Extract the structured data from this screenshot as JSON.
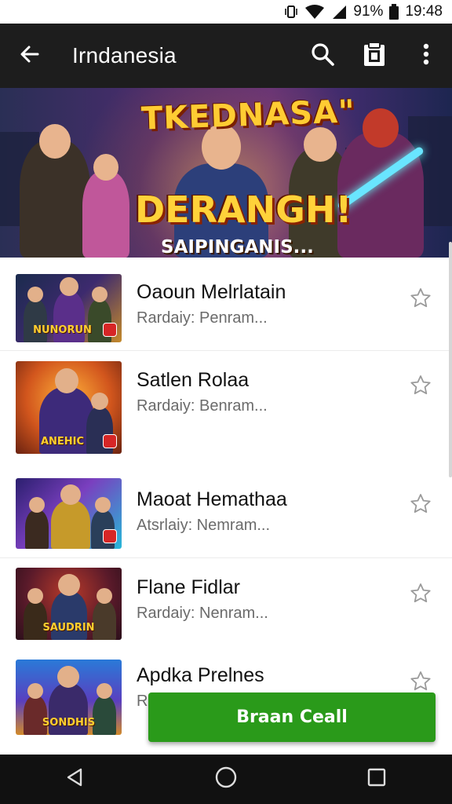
{
  "status_bar": {
    "battery_percent_label": "91%",
    "time": "19:48",
    "icons": [
      "vibrate-icon",
      "wifi-icon",
      "signal-icon",
      "battery-icon"
    ]
  },
  "app_bar": {
    "title": "Irndanesia",
    "icons": [
      "back-arrow-icon",
      "search-icon",
      "clipboard-icon",
      "overflow-menu-icon"
    ]
  },
  "banner": {
    "title": "TKEDNASA\"",
    "headline": "DERANGH!",
    "subheadline": "SAIPINGANIS..."
  },
  "list": {
    "items": [
      {
        "title": "Oaoun Melrlatain",
        "subtitle": "Rardaiy: Penram...",
        "thumb_caption": "NUNORUN",
        "starred": false
      },
      {
        "title": "Satlen Rolaa",
        "subtitle": "Rardaiy: Benram...",
        "thumb_caption": "ANEHIC",
        "starred": false
      },
      {
        "title": "Maoat Hemathaa",
        "subtitle": "Atsrlaiy: Nemram...",
        "thumb_caption": "",
        "starred": false
      },
      {
        "title": "Flane Fidlar",
        "subtitle": "Rardaiy: Nenram...",
        "thumb_caption": "SAUDRIN",
        "starred": false
      },
      {
        "title": "Apdka Prelnes",
        "subtitle": "R",
        "thumb_caption": "SONDHIS",
        "starred": false
      }
    ]
  },
  "cta": {
    "label": "Braan Ceall"
  },
  "colors": {
    "app_bar_bg": "#1d1d1d",
    "cta_green": "#2a9a1a",
    "badge_red": "#d62626",
    "banner_gold": "#ffcc33"
  }
}
